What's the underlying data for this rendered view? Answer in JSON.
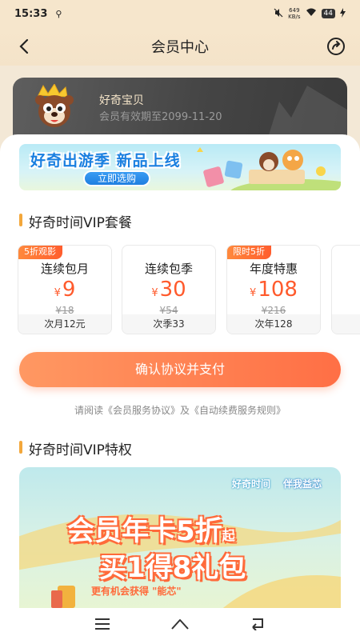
{
  "status_bar": {
    "time": "15:33",
    "usb_icon": "usb-icon",
    "speed_value": "649",
    "speed_unit": "KB/s",
    "battery": "44"
  },
  "header": {
    "title": "会员中心",
    "back_icon": "chevron-left-icon",
    "share_icon": "share-icon"
  },
  "member_card": {
    "name": "好奇宝贝",
    "expire_text": "会员有效期至2099-11-20"
  },
  "banner": {
    "title": "好奇出游季 新品上线",
    "button_label": "立即选购"
  },
  "vip_packages": {
    "section_title": "好奇时间VIP套餐",
    "currency": "¥",
    "items": [
      {
        "badge": "5折观影",
        "name": "连续包月",
        "price": "9",
        "original": "¥18",
        "footer": "次月12元"
      },
      {
        "badge": "",
        "name": "连续包季",
        "price": "30",
        "original": "¥54",
        "footer": "次季33"
      },
      {
        "badge": "限时5折",
        "name": "年度特惠",
        "price": "108",
        "original": "¥216",
        "footer": "次年128"
      }
    ]
  },
  "confirm_button": "确认协议并支付",
  "agreement_text": "请阅读《会员服务协议》及《自动续费服务规则》",
  "privileges": {
    "section_title": "好奇时间VIP特权",
    "logo_1": "好奇时间",
    "logo_2": "伴我益芯",
    "line1_main": "会员年卡5折",
    "line1_small": "起",
    "line2": "买1得8礼包",
    "line3": "更有机会获得  \"能芯\""
  },
  "colors": {
    "accent": "#ff6f45",
    "badge": "#ff5d2e",
    "section_bar": "#f3a73b",
    "background": "#f3e8d6"
  }
}
